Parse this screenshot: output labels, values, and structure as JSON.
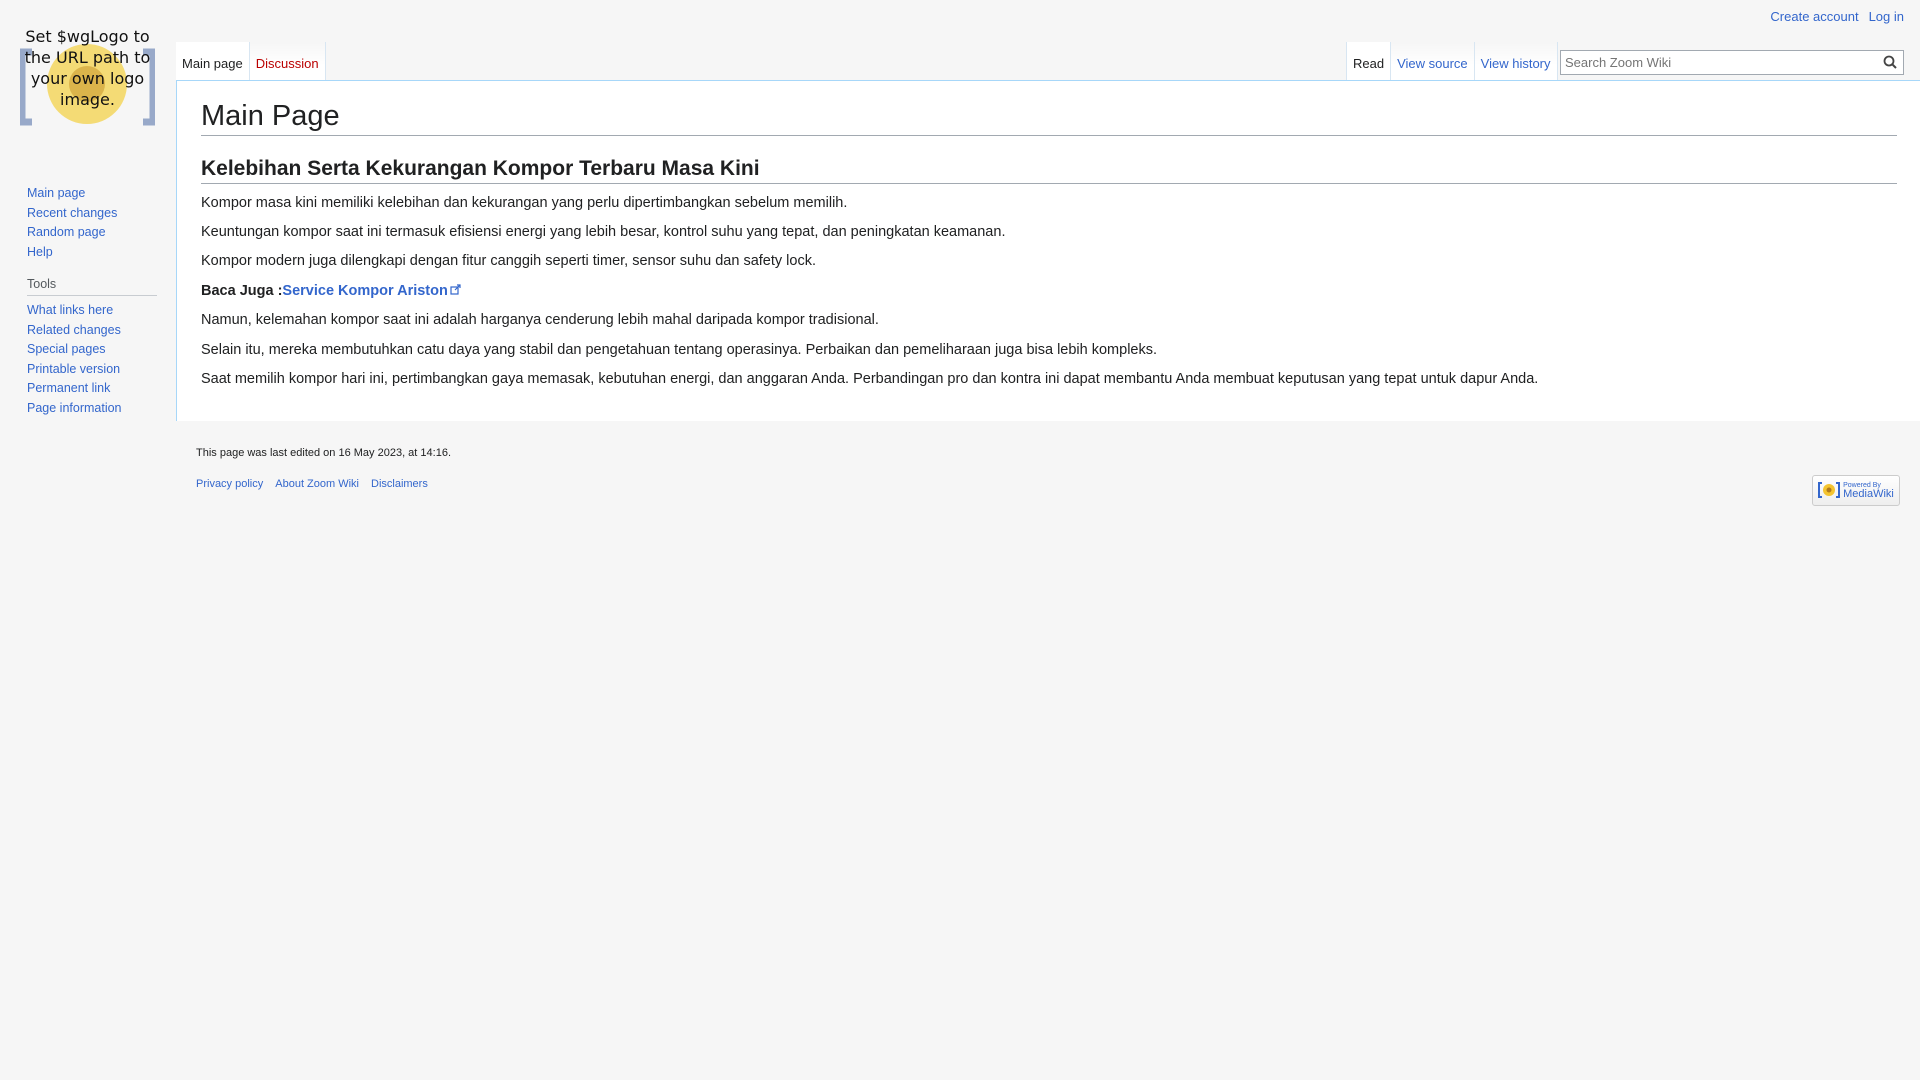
{
  "personal": {
    "create_account": "Create account",
    "log_in": "Log in"
  },
  "logo": {
    "text": "Set $wgLogo to the URL path to your own logo image."
  },
  "tabs": {
    "left": [
      {
        "label": "Main page",
        "selected": true
      },
      {
        "label": "Discussion",
        "selected": false
      }
    ],
    "right": [
      {
        "label": "Read",
        "selected": true
      },
      {
        "label": "View source",
        "selected": false
      },
      {
        "label": "View history",
        "selected": false
      }
    ]
  },
  "search": {
    "placeholder": "Search Zoom Wiki",
    "icon": "search-icon"
  },
  "sidebar": {
    "nav": [
      "Main page",
      "Recent changes",
      "Random page",
      "Help"
    ],
    "tools_heading": "Tools",
    "tools": [
      "What links here",
      "Related changes",
      "Special pages",
      "Printable version",
      "Permanent link",
      "Page information"
    ]
  },
  "content": {
    "title": "Main Page",
    "heading": "Kelebihan Serta Kekurangan Kompor Terbaru Masa Kini",
    "p1": "Kompor masa kini memiliki kelebihan dan kekurangan yang perlu dipertimbangkan sebelum memilih.",
    "p2": "Keuntungan kompor saat ini termasuk efisiensi energi yang lebih besar, kontrol suhu yang tepat, dan peningkatan keamanan.",
    "p3": "Kompor modern juga dilengkapi dengan fitur canggih seperti timer, sensor suhu dan safety lock.",
    "baca_label": "Baca Juga :",
    "baca_link": "Service Kompor Ariston",
    "p5": "Namun, kelemahan kompor saat ini adalah harganya cenderung lebih mahal daripada kompor tradisional.",
    "p6": "Selain itu, mereka membutuhkan catu daya yang stabil dan pengetahuan tentang operasinya. Perbaikan dan pemeliharaan juga bisa lebih kompleks.",
    "p7": "Saat memilih kompor hari ini, pertimbangkan gaya memasak, kebutuhan energi, dan anggaran Anda. Perbandingan pro dan kontra ini dapat membantu Anda membuat keputusan yang tepat untuk dapur Anda."
  },
  "footer": {
    "last_edited": "This page was last edited on 16 May 2023, at 14:16.",
    "links": [
      "Privacy policy",
      "About Zoom Wiki",
      "Disclaimers"
    ],
    "badge": {
      "line1": "Powered By",
      "line2": "MediaWiki"
    }
  }
}
